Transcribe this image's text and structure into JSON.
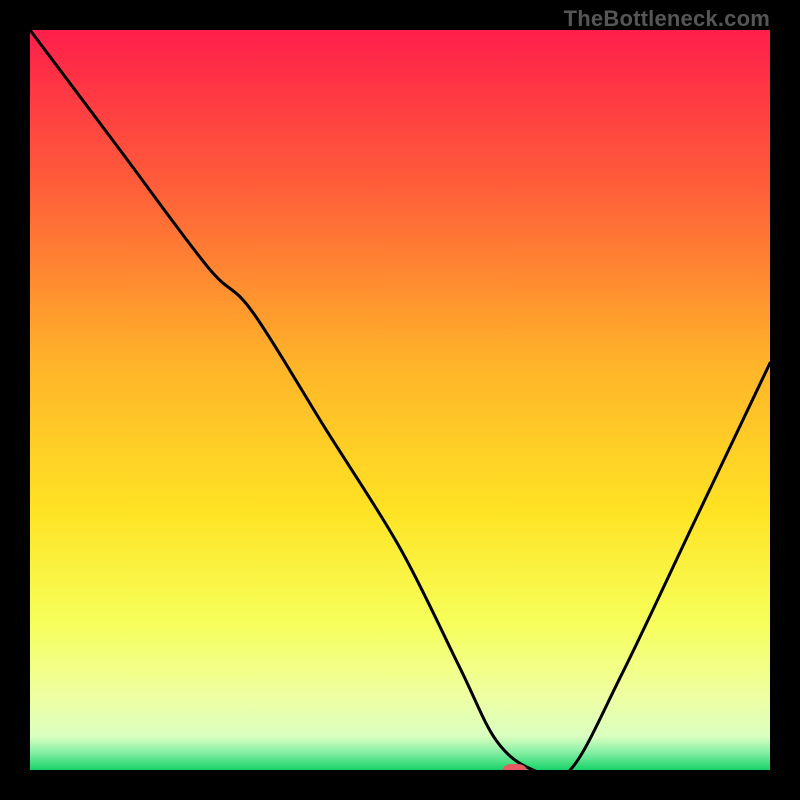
{
  "watermark": "TheBottleneck.com",
  "chart_data": {
    "type": "line",
    "title": "",
    "xlabel": "",
    "ylabel": "",
    "xlim": [
      0,
      100
    ],
    "ylim": [
      0,
      100
    ],
    "grid": false,
    "legend": false,
    "series": [
      {
        "name": "curve",
        "x": [
          0,
          12,
          24,
          30,
          40,
          50,
          58,
          63,
          68,
          73,
          80,
          90,
          100
        ],
        "y": [
          100,
          84,
          68,
          62,
          46,
          30,
          14,
          4,
          0,
          0,
          13,
          34,
          55
        ]
      }
    ],
    "marker": {
      "x": 65.5,
      "y": 0,
      "color": "#e55a63",
      "rx": 12,
      "ry": 6
    },
    "gradient_stops": [
      {
        "offset": 0.0,
        "color": "#ff1f4b"
      },
      {
        "offset": 0.2,
        "color": "#ff5a3a"
      },
      {
        "offset": 0.45,
        "color": "#ffb329"
      },
      {
        "offset": 0.65,
        "color": "#ffe324"
      },
      {
        "offset": 0.8,
        "color": "#f6ff5a"
      },
      {
        "offset": 0.9,
        "color": "#efffa2"
      },
      {
        "offset": 0.955,
        "color": "#d9ffc0"
      },
      {
        "offset": 0.975,
        "color": "#8af0a5"
      },
      {
        "offset": 1.0,
        "color": "#18d36a"
      }
    ]
  }
}
